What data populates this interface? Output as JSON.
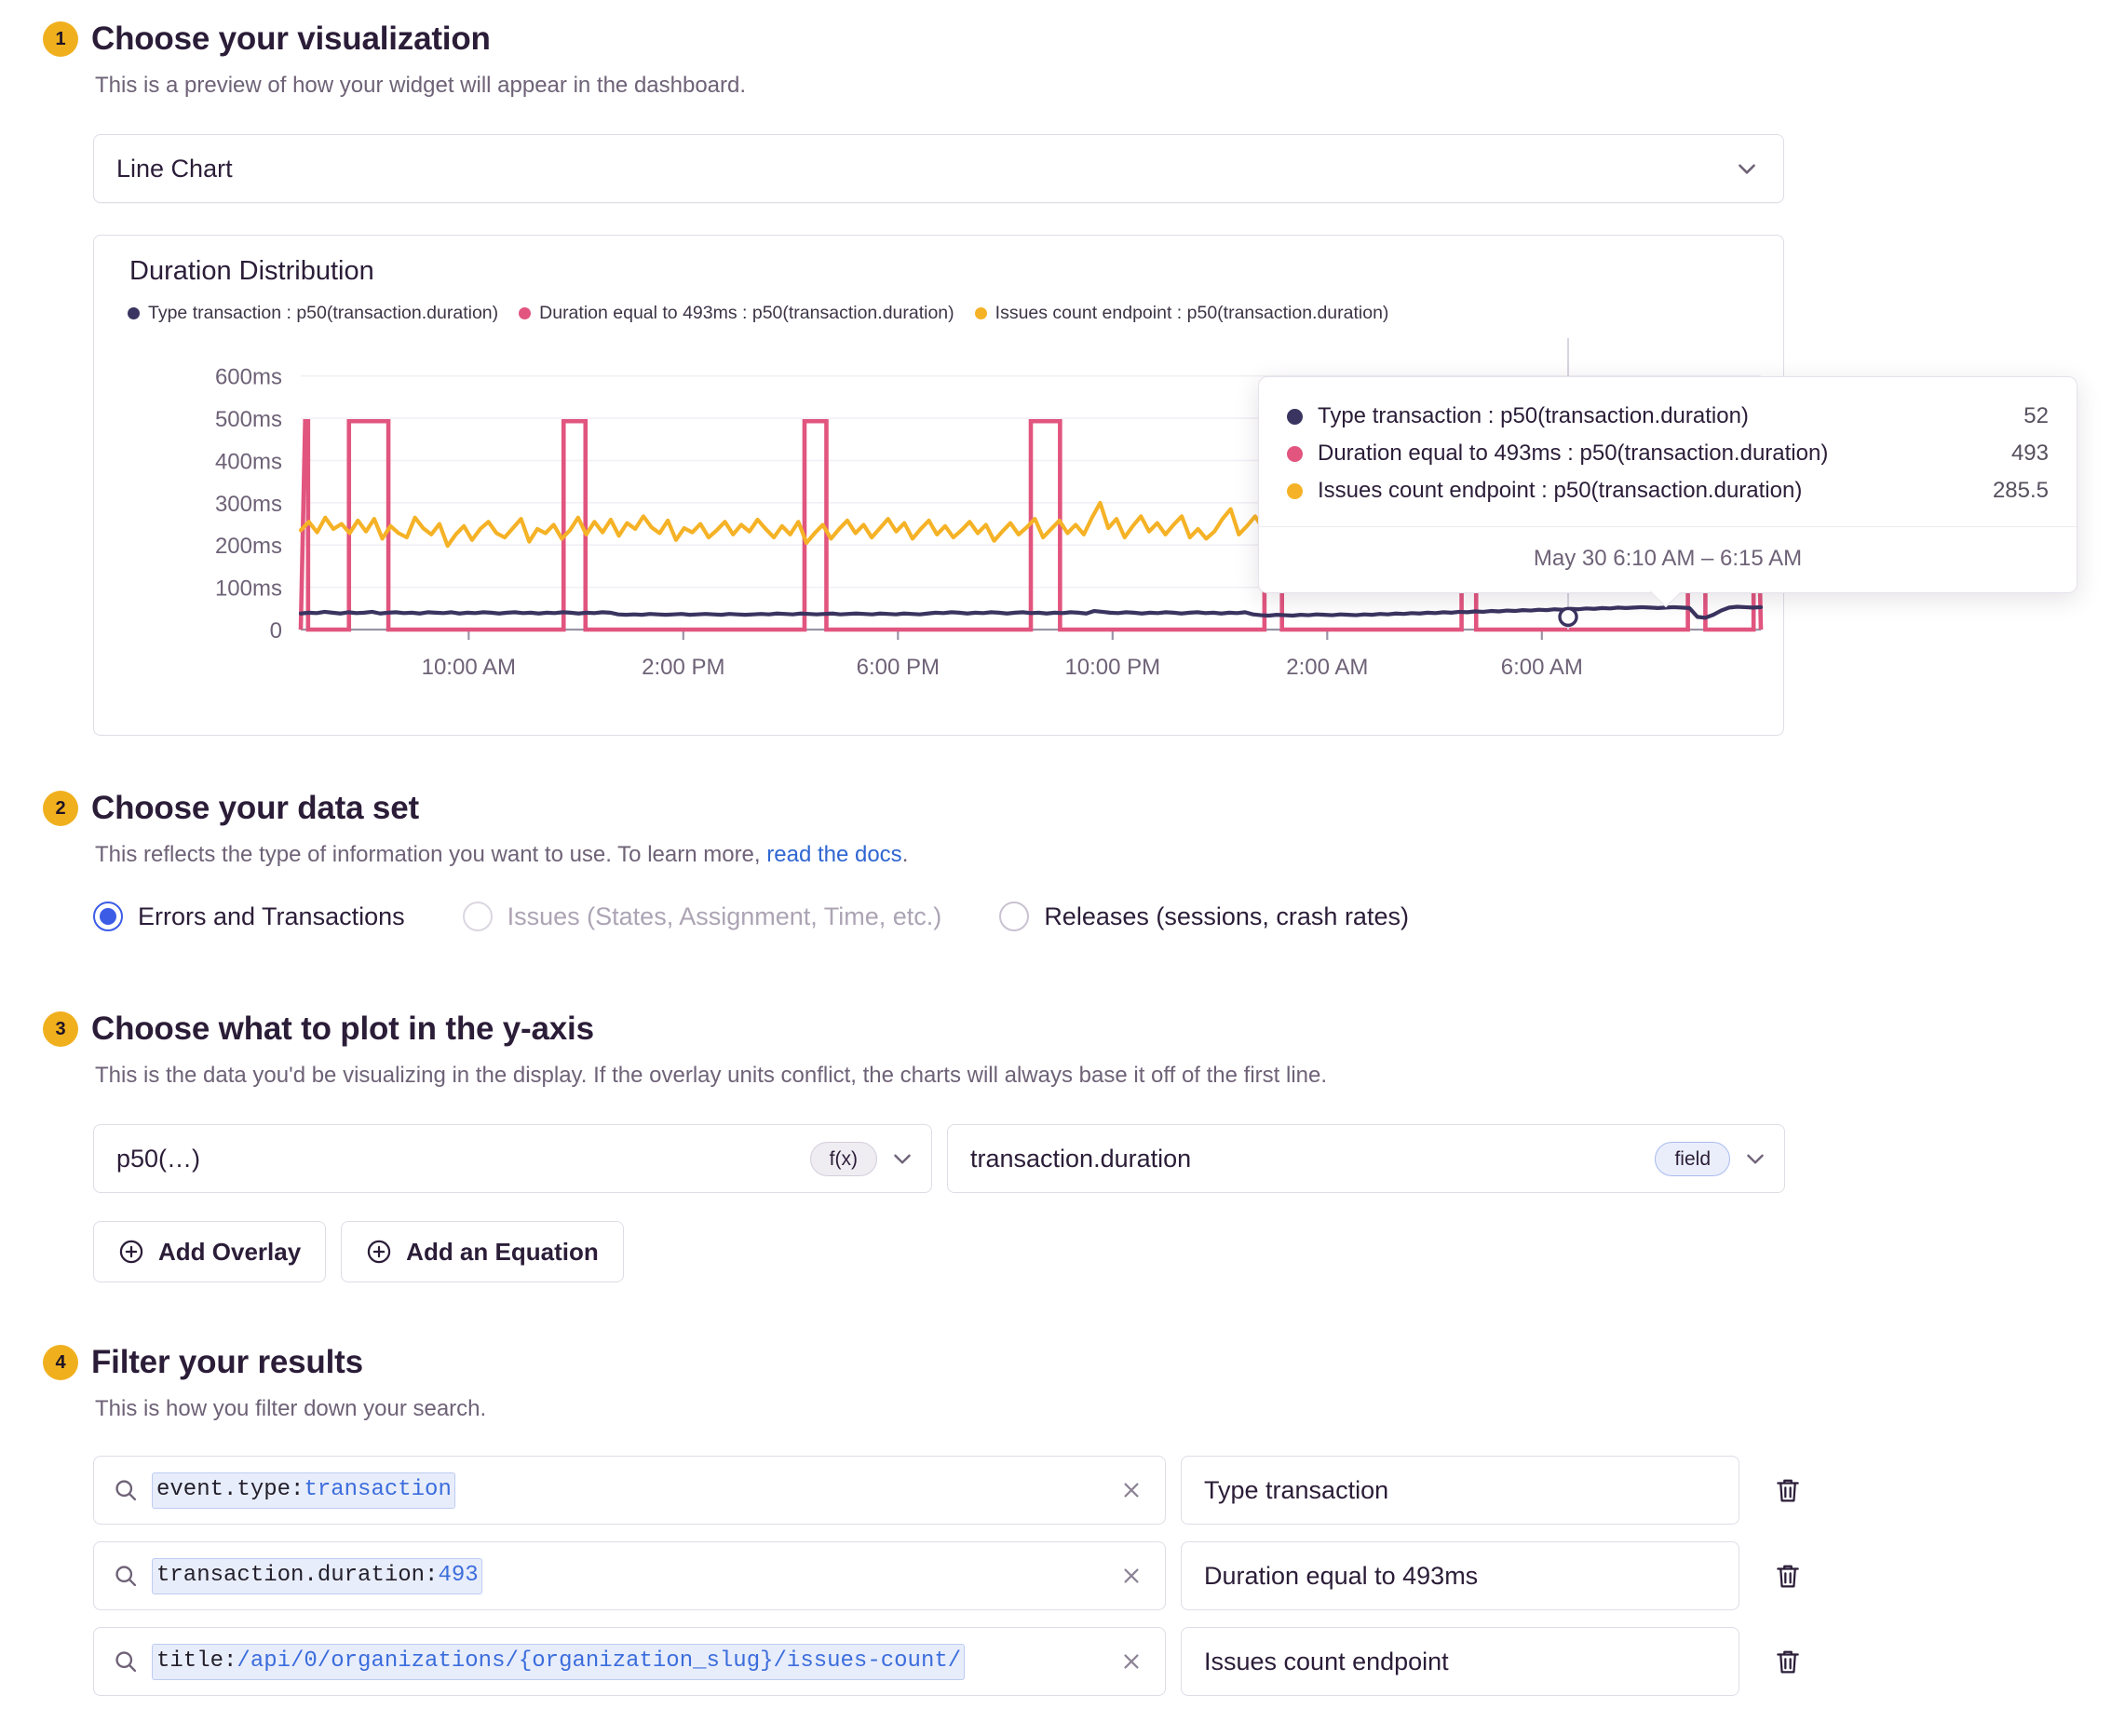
{
  "steps": {
    "one": {
      "number": "1",
      "title": "Choose your visualization",
      "desc": "This is a preview of how your widget will appear in the dashboard."
    },
    "two": {
      "number": "2",
      "title": "Choose your data set",
      "desc_before": "This reflects the type of information you want to use. To learn more, ",
      "link": "read the docs",
      "desc_after": "."
    },
    "three": {
      "number": "3",
      "title": "Choose what to plot in the y-axis",
      "desc": "This is the data you'd be visualizing in the display. If the overlay units conflict, the charts will always base it off of the first line."
    },
    "four": {
      "number": "4",
      "title": "Filter your results",
      "desc": "This is how you filter down your search."
    }
  },
  "visualization": {
    "selected": "Line Chart"
  },
  "dataset": {
    "options": [
      {
        "label": "Errors and Transactions",
        "checked": true,
        "disabled": false
      },
      {
        "label": "Issues (States, Assignment, Time, etc.)",
        "checked": false,
        "disabled": true
      },
      {
        "label": "Releases (sessions, crash rates)",
        "checked": false,
        "disabled": false
      }
    ]
  },
  "yaxis": {
    "aggregate_value": "p50(…)",
    "aggregate_badge": "f(x)",
    "field_value": "transaction.duration",
    "field_badge": "field",
    "add_overlay_label": "Add Overlay",
    "add_equation_label": "Add an Equation"
  },
  "filters": {
    "rows": [
      {
        "key": "event.type:",
        "value": "transaction",
        "label": "Type transaction"
      },
      {
        "key": "transaction.duration:",
        "value": "493",
        "label": "Duration equal to 493ms"
      },
      {
        "key": "title:",
        "value": "/api/0/organizations/{organization_slug}/issues-count/",
        "label": "Issues count endpoint"
      }
    ]
  },
  "tooltip": {
    "rows": [
      {
        "label": "Type transaction : p50(transaction.duration)",
        "value": "52",
        "color": "#3A3460"
      },
      {
        "label": "Duration equal to 493ms : p50(transaction.duration)",
        "value": "493",
        "color": "#E1557F"
      },
      {
        "label": "Issues count endpoint : p50(transaction.duration)",
        "value": "285.5",
        "color": "#F5B226"
      }
    ],
    "footer": "May 30 6:10 AM – 6:15 AM"
  },
  "chart_data": {
    "type": "line",
    "title": "Duration Distribution",
    "xlabel": "",
    "ylabel": "",
    "ylim": [
      0,
      650
    ],
    "yticks": [
      0,
      100,
      200,
      300,
      400,
      500,
      600
    ],
    "ytick_labels": [
      "0",
      "100ms",
      "200ms",
      "300ms",
      "400ms",
      "500ms",
      "600ms"
    ],
    "xtick_labels": [
      "10:00 AM",
      "2:00 PM",
      "6:00 PM",
      "10:00 PM",
      "2:00 AM",
      "6:00 AM"
    ],
    "xtick_positions": [
      0.115,
      0.262,
      0.409,
      0.556,
      0.703,
      0.85
    ],
    "grid": true,
    "legend_position": "top-left",
    "series": [
      {
        "name": "Type transaction : p50(transaction.duration)",
        "color": "#3A3460",
        "values": [
          38,
          40,
          39,
          42,
          40,
          38,
          41,
          39,
          40,
          42,
          38,
          40,
          41,
          39,
          40,
          38,
          41,
          40,
          39,
          41,
          38,
          40,
          39,
          41,
          40,
          38,
          40,
          41,
          39,
          40,
          38,
          40,
          39,
          41,
          40,
          38,
          40,
          39,
          41,
          40,
          36,
          35,
          36,
          35,
          37,
          36,
          35,
          36,
          37,
          35,
          36,
          37,
          36,
          35,
          37,
          36,
          35,
          36,
          37,
          36,
          38,
          37,
          36,
          38,
          37,
          36,
          37,
          38,
          36,
          37,
          38,
          37,
          36,
          38,
          37,
          36,
          38,
          37,
          36,
          38,
          40,
          39,
          41,
          40,
          38,
          40,
          39,
          41,
          40,
          38,
          40,
          41,
          39,
          40,
          38,
          40,
          39,
          41,
          40,
          38,
          44,
          42,
          40,
          39,
          41,
          40,
          38,
          40,
          39,
          41,
          40,
          38,
          40,
          41,
          39,
          40,
          38,
          40,
          39,
          41,
          36,
          34,
          33,
          35,
          34,
          33,
          35,
          34,
          36,
          35,
          34,
          36,
          35,
          34,
          36,
          35,
          37,
          36,
          38,
          37,
          39,
          38,
          40,
          39,
          41,
          40,
          42,
          41,
          43,
          42,
          44,
          43,
          45,
          44,
          46,
          45,
          47,
          46,
          48,
          47,
          49,
          48,
          50,
          49,
          51,
          50,
          52,
          51,
          52,
          53,
          52,
          51,
          52,
          53,
          52,
          51,
          30,
          28,
          35,
          45,
          52,
          54,
          53,
          52,
          53
        ]
      },
      {
        "name": "Duration equal to 493ms : p50(transaction.duration)",
        "color": "#E1557F",
        "description": "Square-wave: constant 493ms with periodic drops to 0",
        "constant_value": 493,
        "gap_positions": [
          0.005,
          0.033,
          0.06,
          0.18,
          0.195,
          0.345,
          0.36,
          0.5,
          0.52,
          0.66,
          0.672,
          0.795,
          0.805,
          0.95,
          0.962,
          0.995
        ]
      },
      {
        "name": "Issues count endpoint : p50(transaction.duration)",
        "color": "#F5B226",
        "values": [
          235,
          255,
          230,
          265,
          238,
          250,
          228,
          258,
          232,
          262,
          215,
          245,
          228,
          218,
          265,
          240,
          225,
          250,
          198,
          225,
          245,
          212,
          238,
          255,
          228,
          218,
          240,
          262,
          208,
          238,
          228,
          248,
          215,
          235,
          265,
          225,
          255,
          230,
          260,
          222,
          252,
          238,
          268,
          242,
          228,
          258,
          212,
          240,
          230,
          250,
          218,
          235,
          255,
          225,
          248,
          232,
          260,
          238,
          218,
          245,
          225,
          255,
          205,
          228,
          248,
          215,
          238,
          258,
          228,
          248,
          218,
          240,
          262,
          232,
          252,
          215,
          238,
          258,
          225,
          245,
          218,
          235,
          255,
          228,
          248,
          210,
          232,
          252,
          225,
          242,
          262,
          218,
          238,
          258,
          228,
          248,
          225,
          265,
          300,
          240,
          262,
          218,
          245,
          268,
          232,
          252,
          225,
          248,
          268,
          218,
          238,
          215,
          232,
          262,
          285,
          225,
          245,
          268,
          238,
          258,
          205,
          225,
          245,
          215,
          238,
          258,
          228,
          248,
          218,
          240,
          262,
          232,
          252,
          272,
          228,
          248,
          200,
          222,
          245,
          215,
          235,
          258,
          228,
          248,
          218,
          242,
          262,
          232,
          255,
          275,
          295,
          252,
          225,
          245,
          265,
          228,
          250,
          270,
          232,
          255,
          275,
          205,
          228,
          248,
          218,
          240,
          262,
          288,
          235,
          258,
          220,
          245,
          265,
          235,
          258,
          278,
          228,
          250,
          272,
          240
        ]
      }
    ]
  },
  "icons": {
    "chevron": "chevron-down-icon",
    "search": "search-icon",
    "clear": "close-icon",
    "delete": "trash-icon",
    "plus": "plus-circle-icon"
  }
}
